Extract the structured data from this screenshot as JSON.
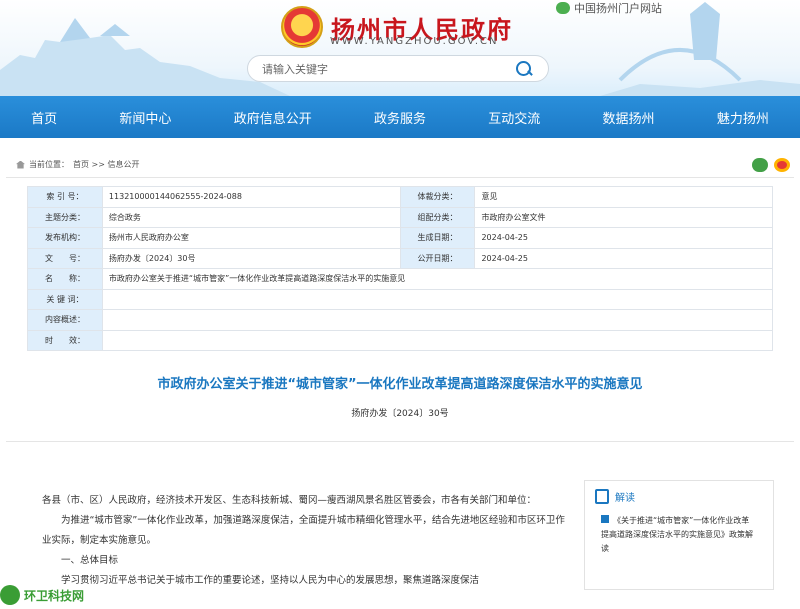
{
  "header": {
    "site_title": "扬州市人民政府",
    "site_url": "WWW.YANGZHOU.GOV.CN",
    "portal_link": "中国扬州门户网站",
    "search_placeholder": "请输入关键字"
  },
  "nav": [
    "首页",
    "新闻中心",
    "政府信息公开",
    "政务服务",
    "互动交流",
    "数据扬州",
    "魅力扬州"
  ],
  "breadcrumb": {
    "label": "当前位置：",
    "path": "首页 >> 信息公开"
  },
  "meta": {
    "rows": [
      {
        "k1": "索 引 号：",
        "v1": "113210000144062555-2024-088",
        "k2": "体裁分类：",
        "v2": "意见"
      },
      {
        "k1": "主题分类：",
        "v1": "综合政务",
        "k2": "组配分类：",
        "v2": "市政府办公室文件"
      },
      {
        "k1": "发布机构：",
        "v1": "扬州市人民政府办公室",
        "k2": "生成日期：",
        "v2": "2024-04-25"
      },
      {
        "k1": "文　　号：",
        "v1": "扬府办发〔2024〕30号",
        "k2": "公开日期：",
        "v2": "2024-04-25"
      }
    ],
    "full_rows": [
      {
        "k": "名　　称：",
        "v": "市政府办公室关于推进“城市管家”一体化作业改革提高道路深度保洁水平的实施意见"
      },
      {
        "k": "关 键 词：",
        "v": ""
      },
      {
        "k": "内容概述：",
        "v": ""
      },
      {
        "k": "时　　效：",
        "v": ""
      }
    ]
  },
  "article": {
    "title": "市政府办公室关于推进“城市管家”一体化作业改革提高道路深度保洁水平的实施意见",
    "doc_number": "扬府办发〔2024〕30号",
    "paragraphs": [
      "各县（市、区）人民政府，经济技术开发区、生态科技新城、蜀冈—瘦西湖风景名胜区管委会，市各有关部门和单位：",
      "为推进“城市管家”一体化作业改革，加强道路深度保洁，全面提升城市精细化管理水平，结合先进地区经验和市区环卫作业实际，制定本实施意见。",
      "一、总体目标",
      "学习贯彻习近平总书记关于城市工作的重要论述，坚持以人民为中心的发展思想，聚焦道路深度保洁"
    ]
  },
  "interpretation": {
    "heading": "解读",
    "link": "《关于推进“城市管家”一体化作业改革提高道路深度保洁水平的实施意见》政策解读"
  },
  "watermark": "环卫科技网"
}
